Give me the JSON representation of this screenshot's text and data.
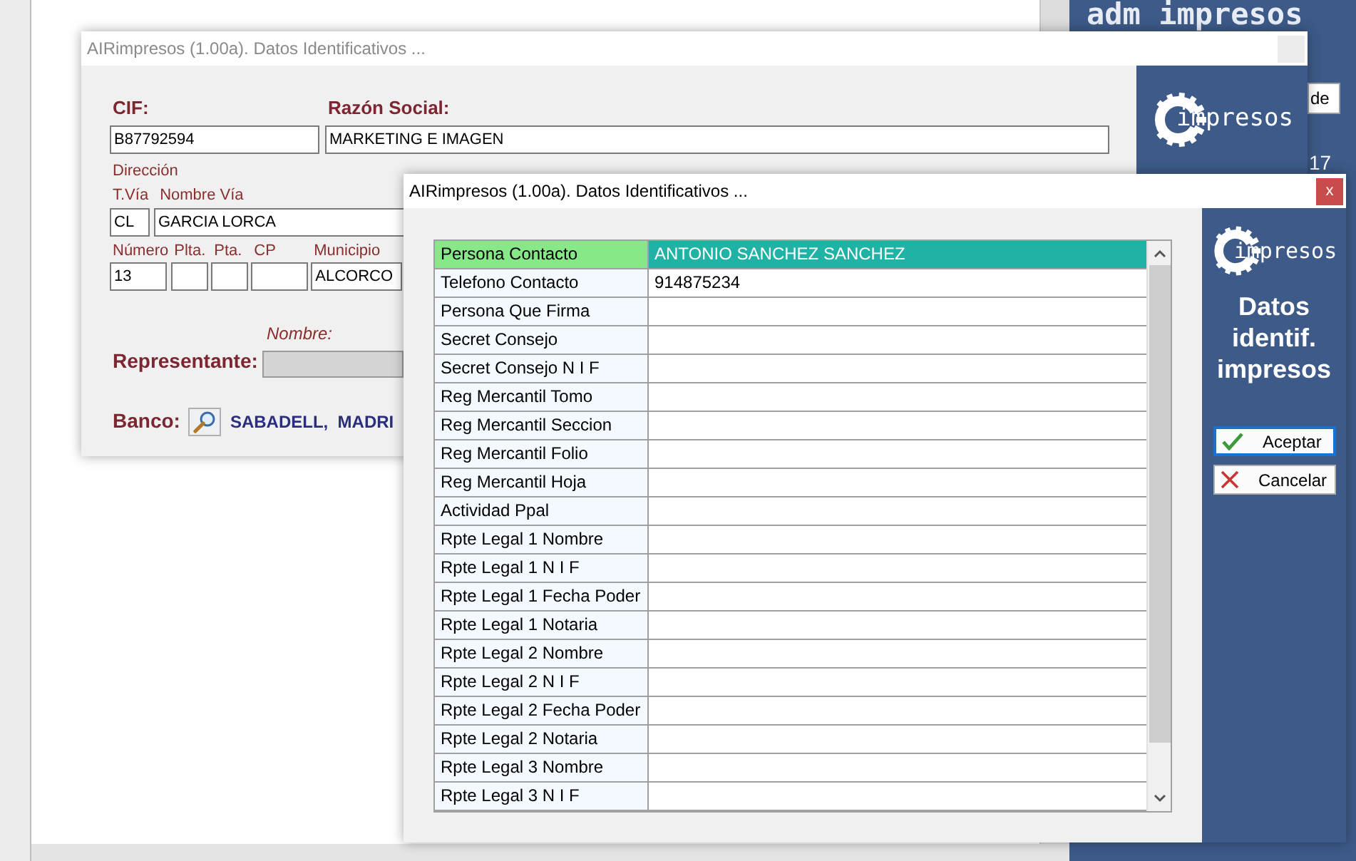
{
  "desktop": {
    "heading": "adm impresos",
    "field_value": "de",
    "count": "17"
  },
  "windows": [
    {
      "kind": "form",
      "title": "AIRimpresos (1.00a). Datos Identificativos ...",
      "active": false,
      "logo_text": "impresos",
      "form": {
        "top_fields": [
          {
            "label": "CIF:",
            "value": "B87792594"
          },
          {
            "label": "Razón Social:",
            "value": "MARKETING E IMAGEN"
          }
        ],
        "section": "Dirección",
        "street_labels": [
          "T.Vía",
          "Nombre Vía"
        ],
        "street_values": [
          "CL",
          "GARCIA LORCA"
        ],
        "address_fields": [
          {
            "label": "Número",
            "value": "13"
          },
          {
            "label": "Plta."
          },
          {
            "label": "Pta."
          },
          {
            "label": "CP"
          },
          {
            "label": "Municipio",
            "value": "ALCORCO"
          }
        ],
        "representante": {
          "label": "Representante:",
          "caption": "Nombre:"
        },
        "banco": {
          "label": "Banco:",
          "value": "SABADELL,  MADRI"
        }
      }
    },
    {
      "kind": "grid",
      "title": "AIRimpresos (1.00a). Datos Identificativos ...",
      "active": true,
      "close_glyph": "x",
      "rows": [
        {
          "label": "Persona Contacto",
          "value": "ANTONIO SANCHEZ SANCHEZ",
          "selected": true
        },
        {
          "label": "Telefono Contacto",
          "value": "914875234",
          "selected": false
        },
        {
          "label": "Persona Que Firma",
          "selected": false
        },
        {
          "label": "Secret Consejo",
          "selected": false
        },
        {
          "label": "Secret Consejo N I F",
          "selected": false
        },
        {
          "label": "Reg Mercantil Tomo",
          "selected": false
        },
        {
          "label": "Reg Mercantil Seccion",
          "selected": false
        },
        {
          "label": "Reg Mercantil Folio",
          "selected": false
        },
        {
          "label": "Reg Mercantil Hoja",
          "selected": false
        },
        {
          "label": "Actividad Ppal",
          "selected": false
        },
        {
          "label": "Rpte Legal 1 Nombre",
          "selected": false
        },
        {
          "label": "Rpte Legal 1 N I F",
          "selected": false
        },
        {
          "label": "Rpte Legal 1 Fecha Poder",
          "selected": false
        },
        {
          "label": "Rpte Legal 1 Notaria",
          "selected": false
        },
        {
          "label": "Rpte Legal 2 Nombre",
          "selected": false
        },
        {
          "label": "Rpte Legal 2 N I F",
          "selected": false
        },
        {
          "label": "Rpte Legal 2 Fecha Poder",
          "selected": false
        },
        {
          "label": "Rpte Legal 2 Notaria",
          "selected": false
        },
        {
          "label": "Rpte Legal 3 Nombre",
          "selected": false
        },
        {
          "label": "Rpte Legal 3 N I F",
          "selected": false
        }
      ],
      "panel": {
        "logo_text": "impresos",
        "heading": "Datos identif. impresos",
        "buttons": [
          {
            "label": "Aceptar",
            "kind": "accept",
            "focused": true
          },
          {
            "label": "Cancelar",
            "kind": "cancel",
            "focused": false
          }
        ]
      }
    }
  ]
}
